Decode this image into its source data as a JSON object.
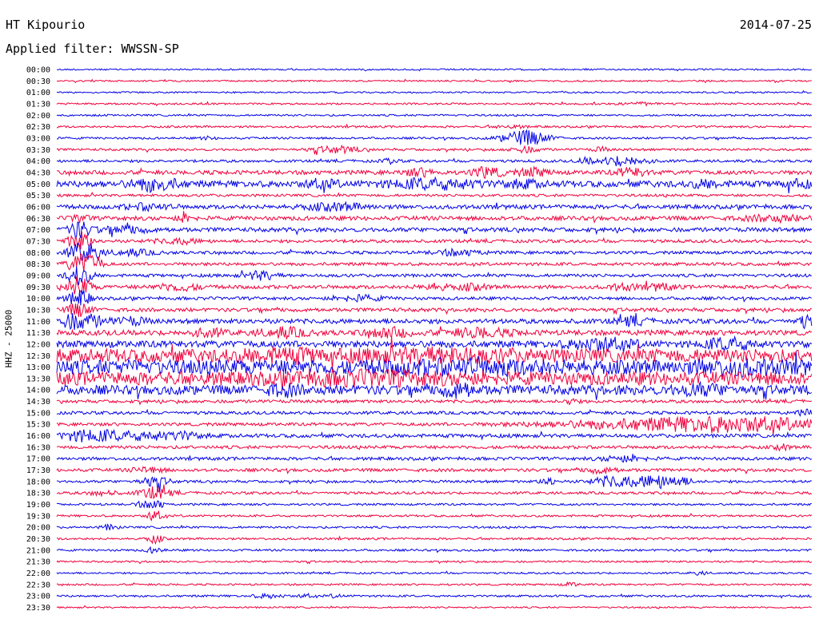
{
  "header": {
    "station": "HT Kipourio",
    "date": "2014-07-25",
    "filter": "Applied filter: WWSSN-SP"
  },
  "chart_data": {
    "type": "line",
    "subtype": "helicorder",
    "ylabel": "HHZ - 25000",
    "colors": [
      "#0000e6",
      "#f0003c"
    ],
    "rows": [
      {
        "label": "00:00",
        "base": 0.3,
        "events": []
      },
      {
        "label": "00:30",
        "base": 0.3,
        "events": []
      },
      {
        "label": "01:00",
        "base": 0.3,
        "events": []
      },
      {
        "label": "01:30",
        "base": 0.35,
        "events": [
          {
            "x": 0.77,
            "w": 0.02,
            "a": 0.5
          }
        ]
      },
      {
        "label": "02:00",
        "base": 0.35,
        "events": []
      },
      {
        "label": "02:30",
        "base": 0.4,
        "events": [
          {
            "x": 0.6,
            "w": 0.02,
            "a": 0.5
          }
        ]
      },
      {
        "label": "03:00",
        "base": 0.4,
        "events": [
          {
            "x": 0.62,
            "w": 0.03,
            "a": 2.8
          },
          {
            "x": 0.2,
            "w": 0.01,
            "a": 0.5
          }
        ]
      },
      {
        "label": "03:30",
        "base": 0.45,
        "events": [
          {
            "x": 0.37,
            "w": 0.03,
            "a": 1.2
          },
          {
            "x": 0.62,
            "w": 0.02,
            "a": 1.0
          },
          {
            "x": 0.72,
            "w": 0.01,
            "a": 0.8
          }
        ]
      },
      {
        "label": "04:00",
        "base": 0.5,
        "events": [
          {
            "x": 0.75,
            "w": 0.03,
            "a": 1.8
          },
          {
            "x": 0.44,
            "w": 0.01,
            "a": 0.8
          },
          {
            "x": 0.7,
            "w": 0.01,
            "a": 1.0
          }
        ]
      },
      {
        "label": "04:30",
        "base": 0.8,
        "events": [
          {
            "x": 0.57,
            "w": 0.02,
            "a": 2.0
          },
          {
            "x": 0.48,
            "w": 0.02,
            "a": 1.2
          },
          {
            "x": 0.63,
            "w": 0.02,
            "a": 1.4
          },
          {
            "x": 0.76,
            "w": 0.02,
            "a": 1.6
          }
        ]
      },
      {
        "label": "05:00",
        "base": 1.2,
        "events": [
          {
            "x": 0.13,
            "w": 0.03,
            "a": 2.2
          },
          {
            "x": 0.5,
            "w": 0.06,
            "a": 1.6
          },
          {
            "x": 0.35,
            "w": 0.02,
            "a": 1.3
          },
          {
            "x": 0.62,
            "w": 0.02,
            "a": 1.2
          },
          {
            "x": 0.86,
            "w": 0.02,
            "a": 1.0
          },
          {
            "x": 0.98,
            "w": 0.02,
            "a": 1.0
          }
        ]
      },
      {
        "label": "05:30",
        "base": 0.5,
        "events": []
      },
      {
        "label": "06:00",
        "base": 0.8,
        "events": [
          {
            "x": 0.37,
            "w": 0.04,
            "a": 1.2
          },
          {
            "x": 0.12,
            "w": 0.03,
            "a": 1.0
          }
        ]
      },
      {
        "label": "06:30",
        "base": 0.8,
        "events": [
          {
            "x": 0.03,
            "w": 0.01,
            "a": 1.5
          },
          {
            "x": 0.17,
            "w": 0.01,
            "a": 1.5
          },
          {
            "x": 0.95,
            "w": 0.04,
            "a": 1.0
          }
        ]
      },
      {
        "label": "07:00",
        "base": 0.8,
        "events": [
          {
            "x": 0.03,
            "w": 0.015,
            "a": 3.0
          },
          {
            "x": 0.09,
            "w": 0.03,
            "a": 1.2
          }
        ]
      },
      {
        "label": "07:30",
        "base": 0.6,
        "events": [
          {
            "x": 0.03,
            "w": 0.015,
            "a": 3.5
          },
          {
            "x": 0.16,
            "w": 0.03,
            "a": 0.9
          }
        ]
      },
      {
        "label": "08:00",
        "base": 0.6,
        "events": [
          {
            "x": 0.03,
            "w": 0.015,
            "a": 3.5
          },
          {
            "x": 0.05,
            "w": 0.01,
            "a": 2.5
          },
          {
            "x": 0.1,
            "w": 0.03,
            "a": 1.0
          },
          {
            "x": 0.53,
            "w": 0.03,
            "a": 1.0
          }
        ]
      },
      {
        "label": "08:30",
        "base": 0.6,
        "events": [
          {
            "x": 0.03,
            "w": 0.015,
            "a": 3.8
          },
          {
            "x": 0.05,
            "w": 0.01,
            "a": 3.0
          }
        ]
      },
      {
        "label": "09:00",
        "base": 0.6,
        "events": [
          {
            "x": 0.27,
            "w": 0.02,
            "a": 1.6
          },
          {
            "x": 0.03,
            "w": 0.015,
            "a": 3.5
          }
        ]
      },
      {
        "label": "09:30",
        "base": 0.7,
        "events": [
          {
            "x": 0.16,
            "w": 0.03,
            "a": 1.2
          },
          {
            "x": 0.5,
            "w": 0.02,
            "a": 1.0
          },
          {
            "x": 0.55,
            "w": 0.02,
            "a": 1.0
          },
          {
            "x": 0.75,
            "w": 0.02,
            "a": 1.0
          },
          {
            "x": 0.8,
            "w": 0.02,
            "a": 1.0
          },
          {
            "x": 0.03,
            "w": 0.015,
            "a": 3.5
          }
        ]
      },
      {
        "label": "10:00",
        "base": 0.6,
        "events": [
          {
            "x": 0.4,
            "w": 0.03,
            "a": 1.0
          },
          {
            "x": 0.03,
            "w": 0.015,
            "a": 3.0
          }
        ]
      },
      {
        "label": "10:30",
        "base": 0.7,
        "events": [
          {
            "x": 0.03,
            "w": 0.015,
            "a": 2.5
          }
        ]
      },
      {
        "label": "11:00",
        "base": 0.9,
        "events": [
          {
            "x": 0.03,
            "w": 0.03,
            "a": 2.8
          },
          {
            "x": 0.1,
            "w": 0.02,
            "a": 1.2
          },
          {
            "x": 0.76,
            "w": 0.02,
            "a": 1.4
          },
          {
            "x": 0.99,
            "w": 0.01,
            "a": 2.0
          }
        ]
      },
      {
        "label": "11:30",
        "base": 1.0,
        "events": [
          {
            "x": 0.3,
            "w": 0.03,
            "a": 1.6
          },
          {
            "x": 0.44,
            "w": 0.03,
            "a": 1.5
          },
          {
            "x": 0.56,
            "w": 0.04,
            "a": 1.5
          },
          {
            "x": 0.2,
            "w": 0.02,
            "a": 1.3
          }
        ]
      },
      {
        "label": "12:00",
        "base": 1.3,
        "events": [
          {
            "x": 0.72,
            "w": 0.04,
            "a": 2.0
          },
          {
            "x": 0.89,
            "w": 0.03,
            "a": 2.0
          }
        ]
      },
      {
        "label": "12:30",
        "base": 2.6,
        "events": [
          {
            "x": 0.5,
            "w": 0.1,
            "a": 1.2
          },
          {
            "x": 0.3,
            "w": 0.05,
            "a": 1.2
          }
        ]
      },
      {
        "label": "13:00",
        "base": 2.8,
        "events": [
          {
            "x": 0.55,
            "w": 0.1,
            "a": 1.2
          },
          {
            "x": 0.9,
            "w": 0.05,
            "a": 1.2
          }
        ]
      },
      {
        "label": "13:30",
        "base": 2.6,
        "events": [
          {
            "x": 0.4,
            "w": 0.1,
            "a": 1.2
          }
        ]
      },
      {
        "label": "14:00",
        "base": 1.8,
        "events": [
          {
            "x": 0.53,
            "w": 0.02,
            "a": 2.0
          },
          {
            "x": 0.85,
            "w": 0.03,
            "a": 1.4
          },
          {
            "x": 0.3,
            "w": 0.02,
            "a": 1.5
          }
        ]
      },
      {
        "label": "14:30",
        "base": 0.6,
        "events": [
          {
            "x": 0.68,
            "w": 0.01,
            "a": 1.0
          }
        ]
      },
      {
        "label": "15:00",
        "base": 0.6,
        "events": [
          {
            "x": 0.99,
            "w": 0.01,
            "a": 1.0
          }
        ]
      },
      {
        "label": "15:30",
        "base": 0.6,
        "events": [
          {
            "x": 0.8,
            "w": 0.15,
            "a": 1.8
          },
          {
            "x": 0.92,
            "w": 0.1,
            "a": 1.8
          }
        ]
      },
      {
        "label": "16:00",
        "base": 0.7,
        "events": [
          {
            "x": 0.04,
            "w": 0.04,
            "a": 1.8
          },
          {
            "x": 0.12,
            "w": 0.06,
            "a": 1.4
          },
          {
            "x": 0.17,
            "w": 0.01,
            "a": 1.0
          }
        ]
      },
      {
        "label": "16:30",
        "base": 0.6,
        "events": [
          {
            "x": 0.96,
            "w": 0.01,
            "a": 1.0
          }
        ]
      },
      {
        "label": "17:00",
        "base": 0.6,
        "events": [
          {
            "x": 0.75,
            "w": 0.03,
            "a": 1.0
          }
        ]
      },
      {
        "label": "17:30",
        "base": 0.6,
        "events": [
          {
            "x": 0.12,
            "w": 0.02,
            "a": 1.0
          },
          {
            "x": 0.72,
            "w": 0.02,
            "a": 1.0
          }
        ]
      },
      {
        "label": "18:00",
        "base": 0.5,
        "events": [
          {
            "x": 0.74,
            "w": 0.03,
            "a": 2.2
          },
          {
            "x": 0.79,
            "w": 0.02,
            "a": 2.2
          },
          {
            "x": 0.82,
            "w": 0.02,
            "a": 1.6
          },
          {
            "x": 0.65,
            "w": 0.01,
            "a": 1.5
          },
          {
            "x": 0.13,
            "w": 0.02,
            "a": 1.6
          }
        ]
      },
      {
        "label": "18:30",
        "base": 0.5,
        "events": [
          {
            "x": 0.13,
            "w": 0.02,
            "a": 2.2
          },
          {
            "x": 0.06,
            "w": 0.02,
            "a": 0.8
          }
        ]
      },
      {
        "label": "19:00",
        "base": 0.4,
        "events": [
          {
            "x": 0.11,
            "w": 0.01,
            "a": 0.8
          },
          {
            "x": 0.13,
            "w": 0.01,
            "a": 2.0
          }
        ]
      },
      {
        "label": "19:30",
        "base": 0.4,
        "events": [
          {
            "x": 0.13,
            "w": 0.01,
            "a": 2.0
          }
        ]
      },
      {
        "label": "20:00",
        "base": 0.4,
        "events": [
          {
            "x": 0.07,
            "w": 0.01,
            "a": 1.0
          }
        ]
      },
      {
        "label": "20:30",
        "base": 0.4,
        "events": [
          {
            "x": 0.13,
            "w": 0.01,
            "a": 1.5
          }
        ]
      },
      {
        "label": "21:00",
        "base": 0.4,
        "events": [
          {
            "x": 0.13,
            "w": 0.01,
            "a": 1.2
          }
        ]
      },
      {
        "label": "21:30",
        "base": 0.35,
        "events": []
      },
      {
        "label": "22:00",
        "base": 0.35,
        "events": [
          {
            "x": 0.85,
            "w": 0.01,
            "a": 0.6
          }
        ]
      },
      {
        "label": "22:30",
        "base": 0.35,
        "events": [
          {
            "x": 0.68,
            "w": 0.01,
            "a": 0.7
          }
        ]
      },
      {
        "label": "23:00",
        "base": 0.4,
        "events": [
          {
            "x": 0.28,
            "w": 0.02,
            "a": 0.7
          },
          {
            "x": 0.33,
            "w": 0.01,
            "a": 0.6
          },
          {
            "x": 0.37,
            "w": 0.01,
            "a": 0.6
          }
        ]
      },
      {
        "label": "23:30",
        "base": 0.3,
        "events": []
      }
    ]
  }
}
